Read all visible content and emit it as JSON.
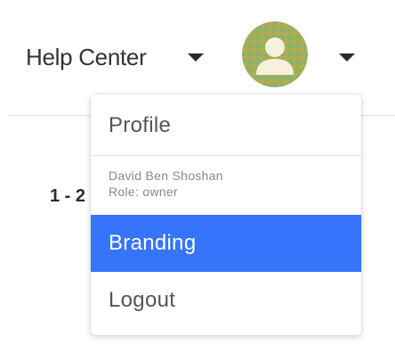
{
  "header": {
    "help_center_label": "Help Center"
  },
  "avatar": {
    "bg_color": "#8bb36a",
    "pattern_color": "#d8a13a",
    "figure_color": "#f6f0dd"
  },
  "background": {
    "pagination_partial": "1 - 2"
  },
  "user_menu": {
    "profile_label": "Profile",
    "user_name": "David Ben Shoshan",
    "user_role": "Role: owner",
    "branding_label": "Branding",
    "logout_label": "Logout",
    "active_color": "#3574fb"
  }
}
